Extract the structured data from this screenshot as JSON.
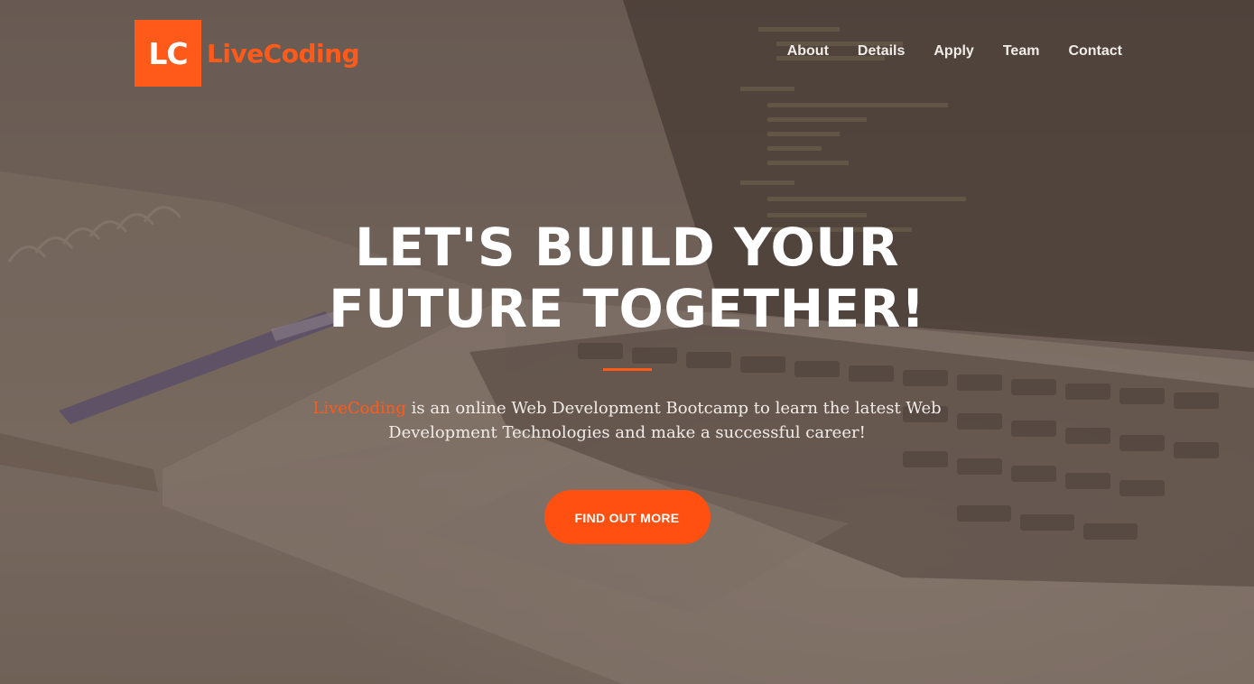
{
  "brand": {
    "mark": "LC",
    "name": "LiveCoding"
  },
  "nav": {
    "items": [
      {
        "label": "About"
      },
      {
        "label": "Details"
      },
      {
        "label": "Apply"
      },
      {
        "label": "Team"
      },
      {
        "label": "Contact"
      }
    ]
  },
  "hero": {
    "title": "LET'S BUILD YOUR FUTURE TOGETHER!",
    "text_accent": "LiveCoding",
    "text_rest": " is an online Web Development Bootcamp to learn the latest Web Development Technologies and make a successful career!",
    "cta_label": "FIND OUT MORE"
  },
  "colors": {
    "accent": "#ff5a1a",
    "text": "#ffffff"
  }
}
